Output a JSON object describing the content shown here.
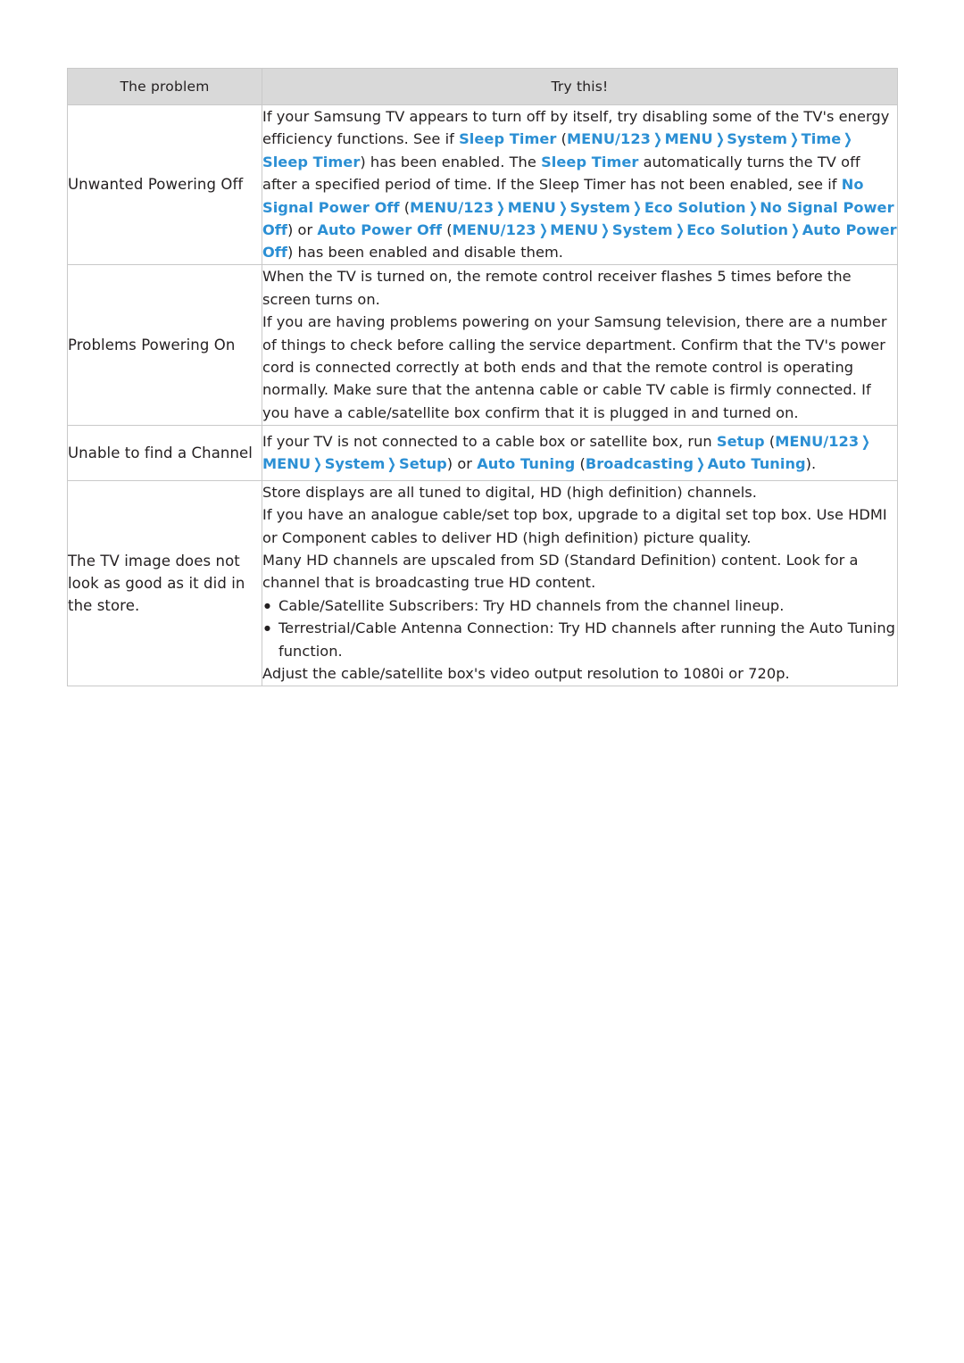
{
  "table": {
    "headers": [
      "The problem",
      "Try this!"
    ],
    "rows": [
      {
        "problem": "Unwanted Powering Off",
        "answer_segments": [
          {
            "t": "If your Samsung TV appears to turn off by itself, try disabling some of the TV's energy efficiency functions. See if ",
            "s": "plain"
          },
          {
            "t": "Sleep Timer",
            "s": "blue"
          },
          {
            "t": " (",
            "s": "plain"
          },
          {
            "t": "MENU/123",
            "s": "blue"
          },
          {
            "t": "❯",
            "s": "arrow"
          },
          {
            "t": "MENU",
            "s": "blue"
          },
          {
            "t": "❯",
            "s": "arrow"
          },
          {
            "t": "System",
            "s": "blue"
          },
          {
            "t": "❯",
            "s": "arrow"
          },
          {
            "t": "Time",
            "s": "blue"
          },
          {
            "t": "❯",
            "s": "arrow"
          },
          {
            "t": "Sleep Timer",
            "s": "blue"
          },
          {
            "t": ") has been enabled. The ",
            "s": "plain"
          },
          {
            "t": "Sleep Timer",
            "s": "blue"
          },
          {
            "t": " automatically turns the TV off after a specified period of time. If the Sleep Timer has not been enabled, see if ",
            "s": "plain"
          },
          {
            "t": "No Signal Power Off",
            "s": "blue"
          },
          {
            "t": " (",
            "s": "plain"
          },
          {
            "t": "MENU/123",
            "s": "blue"
          },
          {
            "t": "❯",
            "s": "arrow"
          },
          {
            "t": "MENU",
            "s": "blue"
          },
          {
            "t": "❯",
            "s": "arrow"
          },
          {
            "t": "System",
            "s": "blue"
          },
          {
            "t": "❯",
            "s": "arrow"
          },
          {
            "t": "Eco Solution",
            "s": "blue"
          },
          {
            "t": "❯",
            "s": "arrow"
          },
          {
            "t": "No Signal Power Off",
            "s": "blue"
          },
          {
            "t": ") or ",
            "s": "plain"
          },
          {
            "t": "Auto Power Off",
            "s": "blue"
          },
          {
            "t": " (",
            "s": "plain"
          },
          {
            "t": "MENU/123",
            "s": "blue"
          },
          {
            "t": "❯",
            "s": "arrow"
          },
          {
            "t": "MENU",
            "s": "blue"
          },
          {
            "t": "❯",
            "s": "arrow"
          },
          {
            "t": "System",
            "s": "blue"
          },
          {
            "t": "❯",
            "s": "arrow"
          },
          {
            "t": "Eco Solution",
            "s": "blue"
          },
          {
            "t": "❯",
            "s": "arrow"
          },
          {
            "t": "Auto Power Off",
            "s": "blue"
          },
          {
            "t": ") has been enabled and disable them.",
            "s": "plain"
          }
        ]
      },
      {
        "problem": "Problems Powering On",
        "answer_segments": [
          {
            "t": "When the TV is turned on, the remote control receiver flashes 5 times before the screen turns on.",
            "s": "plain"
          },
          {
            "t": "\n",
            "s": "break"
          },
          {
            "t": "If you are having problems powering on your Samsung television, there are a number of things to check before calling the service department. Confirm that the TV's power cord is connected correctly at both ends and that the remote control is operating normally. Make sure that the antenna cable or cable TV cable is firmly connected. If you have a cable/satellite box confirm that it is plugged in and turned on.",
            "s": "plain"
          }
        ]
      },
      {
        "problem": "Unable to find a Channel",
        "answer_segments": [
          {
            "t": "If your TV is not connected to a cable box or satellite box, run ",
            "s": "plain"
          },
          {
            "t": "Setup",
            "s": "blue"
          },
          {
            "t": " (",
            "s": "plain"
          },
          {
            "t": "MENU/123",
            "s": "blue"
          },
          {
            "t": "❯",
            "s": "arrow"
          },
          {
            "t": "MENU",
            "s": "blue"
          },
          {
            "t": "❯",
            "s": "arrow"
          },
          {
            "t": "System",
            "s": "blue"
          },
          {
            "t": "❯",
            "s": "arrow"
          },
          {
            "t": "Setup",
            "s": "blue"
          },
          {
            "t": ") or ",
            "s": "plain"
          },
          {
            "t": "Auto Tuning",
            "s": "blue"
          },
          {
            "t": " (",
            "s": "plain"
          },
          {
            "t": "Broadcasting",
            "s": "blue"
          },
          {
            "t": "❯",
            "s": "arrow"
          },
          {
            "t": "Auto Tuning",
            "s": "blue"
          },
          {
            "t": ").",
            "s": "plain"
          }
        ]
      },
      {
        "problem": "The TV image does not look as good as it did in the store.",
        "paragraphs": [
          "Store displays are all tuned to digital, HD (high definition) channels.",
          "If you have an analogue cable/set top box, upgrade to a digital set top box. Use HDMI or Component cables to deliver HD (high definition) picture quality.",
          "Many HD channels are upscaled from SD (Standard Definition) content. Look for a channel that is broadcasting true HD content."
        ],
        "bullets": [
          "Cable/Satellite Subscribers: Try HD channels from the channel lineup.",
          "Terrestrial/Cable Antenna Connection: Try HD channels after running the Auto Tuning function."
        ],
        "closing": "Adjust the cable/satellite box's video output resolution to 1080i or 720p."
      }
    ]
  },
  "colors": {
    "link": "#2b8fd4",
    "header_bg": "#d9d9d9",
    "border": "#c9c9c9",
    "text": "#231f20"
  }
}
